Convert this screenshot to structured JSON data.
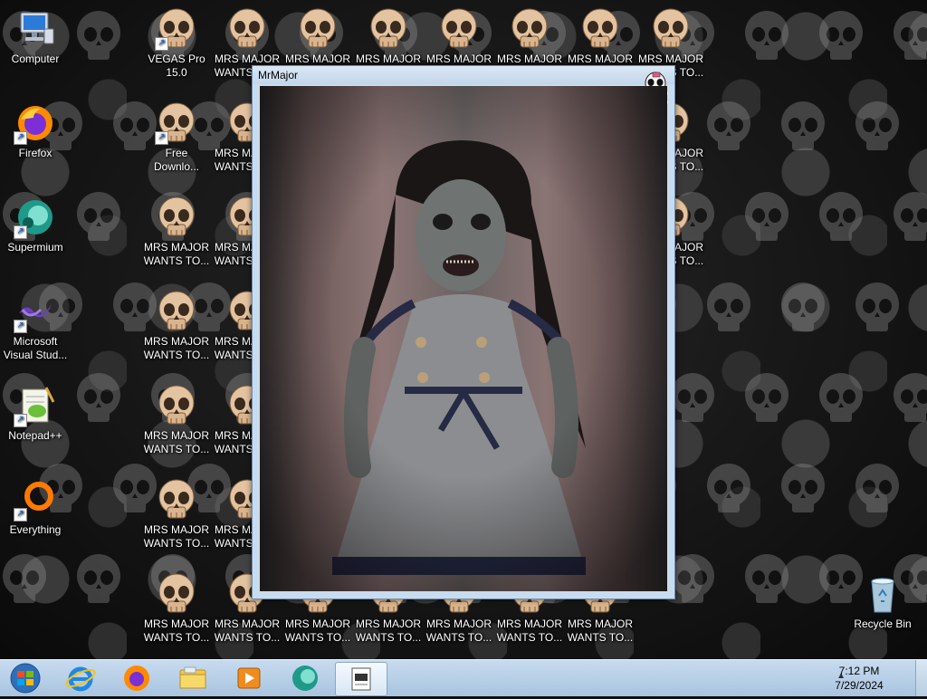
{
  "desktop": {
    "left_icons": [
      {
        "label": "Computer",
        "icon": "computer-icon"
      },
      {
        "label": "Firefox",
        "icon": "firefox-icon"
      },
      {
        "label": "Supermium",
        "icon": "supermium-icon"
      },
      {
        "label": "Microsoft Visual Stud...",
        "icon": "visual-studio-icon"
      },
      {
        "label": "Notepad++",
        "icon": "notepad-plus-plus-icon"
      },
      {
        "label": "Everything",
        "icon": "everything-icon"
      }
    ],
    "skull_icons": [
      {
        "label": "VEGAS Pro 15.0"
      },
      {
        "label": "MRS MAJOR WANTS TO..."
      },
      {
        "label": "MRS MAJOR WANTS TO..."
      },
      {
        "label": "MRS MAJOR WANTS TO..."
      },
      {
        "label": "MRS MAJOR WANTS TO..."
      },
      {
        "label": "MRS MAJOR WANTS TO..."
      },
      {
        "label": "MRS MAJOR WANTS TO..."
      },
      {
        "label": "MRS MAJOR WANTS TO..."
      },
      {
        "label": "Free Downlo..."
      },
      {
        "label": "MRS MAJOR WANTS TO..."
      },
      {
        "label": "MRS MAJOR WANTS TO..."
      },
      {
        "label": "MRS MAJOR WANTS TO..."
      },
      {
        "label": "MRS MAJOR WANTS TO..."
      },
      {
        "label": "MRS MAJOR WANTS TO..."
      },
      {
        "label": "MRS MAJOR WANTS TO..."
      },
      {
        "label": "MRS MAJOR WANTS TO..."
      },
      {
        "label": "MRS MAJOR WANTS TO..."
      },
      {
        "label": "MRS MAJOR WANTS TO..."
      },
      {
        "label": "MRS MAJOR WANTS TO..."
      },
      {
        "label": "MRS MAJOR WANTS TO..."
      },
      {
        "label": "MRS MAJOR WANTS TO..."
      },
      {
        "label": "MRS MAJOR WANTS TO..."
      },
      {
        "label": "MRS MAJOR WANTS TO..."
      },
      {
        "label": "MRS MAJOR WANTS TO..."
      },
      {
        "label": "MRS MAJOR WANTS TO..."
      },
      {
        "label": "MRS MAJOR WANTS TO..."
      },
      {
        "label": "MRS MAJOR WANTS TO..."
      },
      {
        "label": "MRS MAJOR WANTS TO..."
      },
      {
        "label": "MRS MAJOR WANTS TO..."
      },
      {
        "label": "MRS MAJOR WANTS TO..."
      },
      {
        "label": "MRS MAJOR WANTS TO..."
      },
      {
        "label": "MRS MAJOR WANTS TO..."
      }
    ],
    "recycle_bin": {
      "label": "Recycle Bin"
    }
  },
  "window": {
    "title": "MrMajor",
    "close_icon": "skull-crossbones-icon",
    "content": "creepy-doll-image"
  },
  "taskbar": {
    "start_icon": "windows-start-icon",
    "pinned": [
      "internet-explorer-icon",
      "firefox-icon",
      "file-explorer-icon",
      "media-player-icon",
      "supermium-icon"
    ],
    "active_item": "mrmajor-app-icon",
    "time": "7:12 PM",
    "date": "7/29/2024"
  },
  "colors": {
    "taskbar": "#b9d1ea",
    "window_frame": "#c9dcee",
    "icon_text": "#ffffff"
  }
}
